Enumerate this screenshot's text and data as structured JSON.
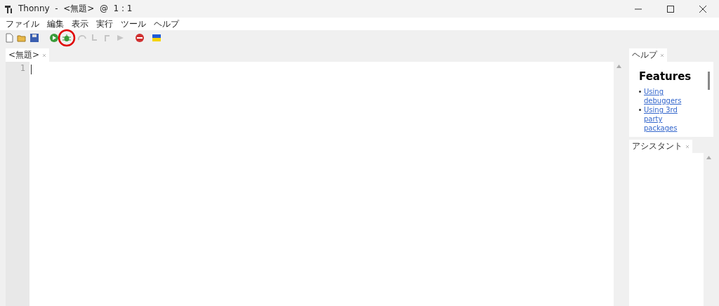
{
  "window": {
    "title": "Thonny  -  <無題>  @  1 : 1"
  },
  "menu": [
    "ファイル",
    "編集",
    "表示",
    "実行",
    "ツール",
    "ヘルプ"
  ],
  "toolbar": [
    {
      "kind": "new",
      "disabled": false,
      "highlighted": false
    },
    {
      "kind": "open",
      "disabled": false,
      "highlighted": false
    },
    {
      "kind": "save",
      "disabled": false,
      "highlighted": false
    },
    {
      "kind": "run",
      "disabled": false,
      "highlighted": false
    },
    {
      "kind": "debug",
      "disabled": false,
      "highlighted": true
    },
    {
      "kind": "step-over",
      "disabled": true,
      "highlighted": false
    },
    {
      "kind": "step-into",
      "disabled": true,
      "highlighted": false
    },
    {
      "kind": "step-out",
      "disabled": true,
      "highlighted": false
    },
    {
      "kind": "resume",
      "disabled": true,
      "highlighted": false
    },
    {
      "kind": "stop",
      "disabled": false,
      "highlighted": false
    },
    {
      "kind": "flag",
      "disabled": false,
      "highlighted": false
    }
  ],
  "editor": {
    "tab": "<無題>",
    "line_numbers": [
      "1"
    ]
  },
  "help": {
    "tab": "ヘルプ",
    "heading": "Features",
    "links": [
      "Using debuggers",
      "Using 3rd party packages"
    ]
  },
  "assistant": {
    "tab": "アシスタント"
  }
}
